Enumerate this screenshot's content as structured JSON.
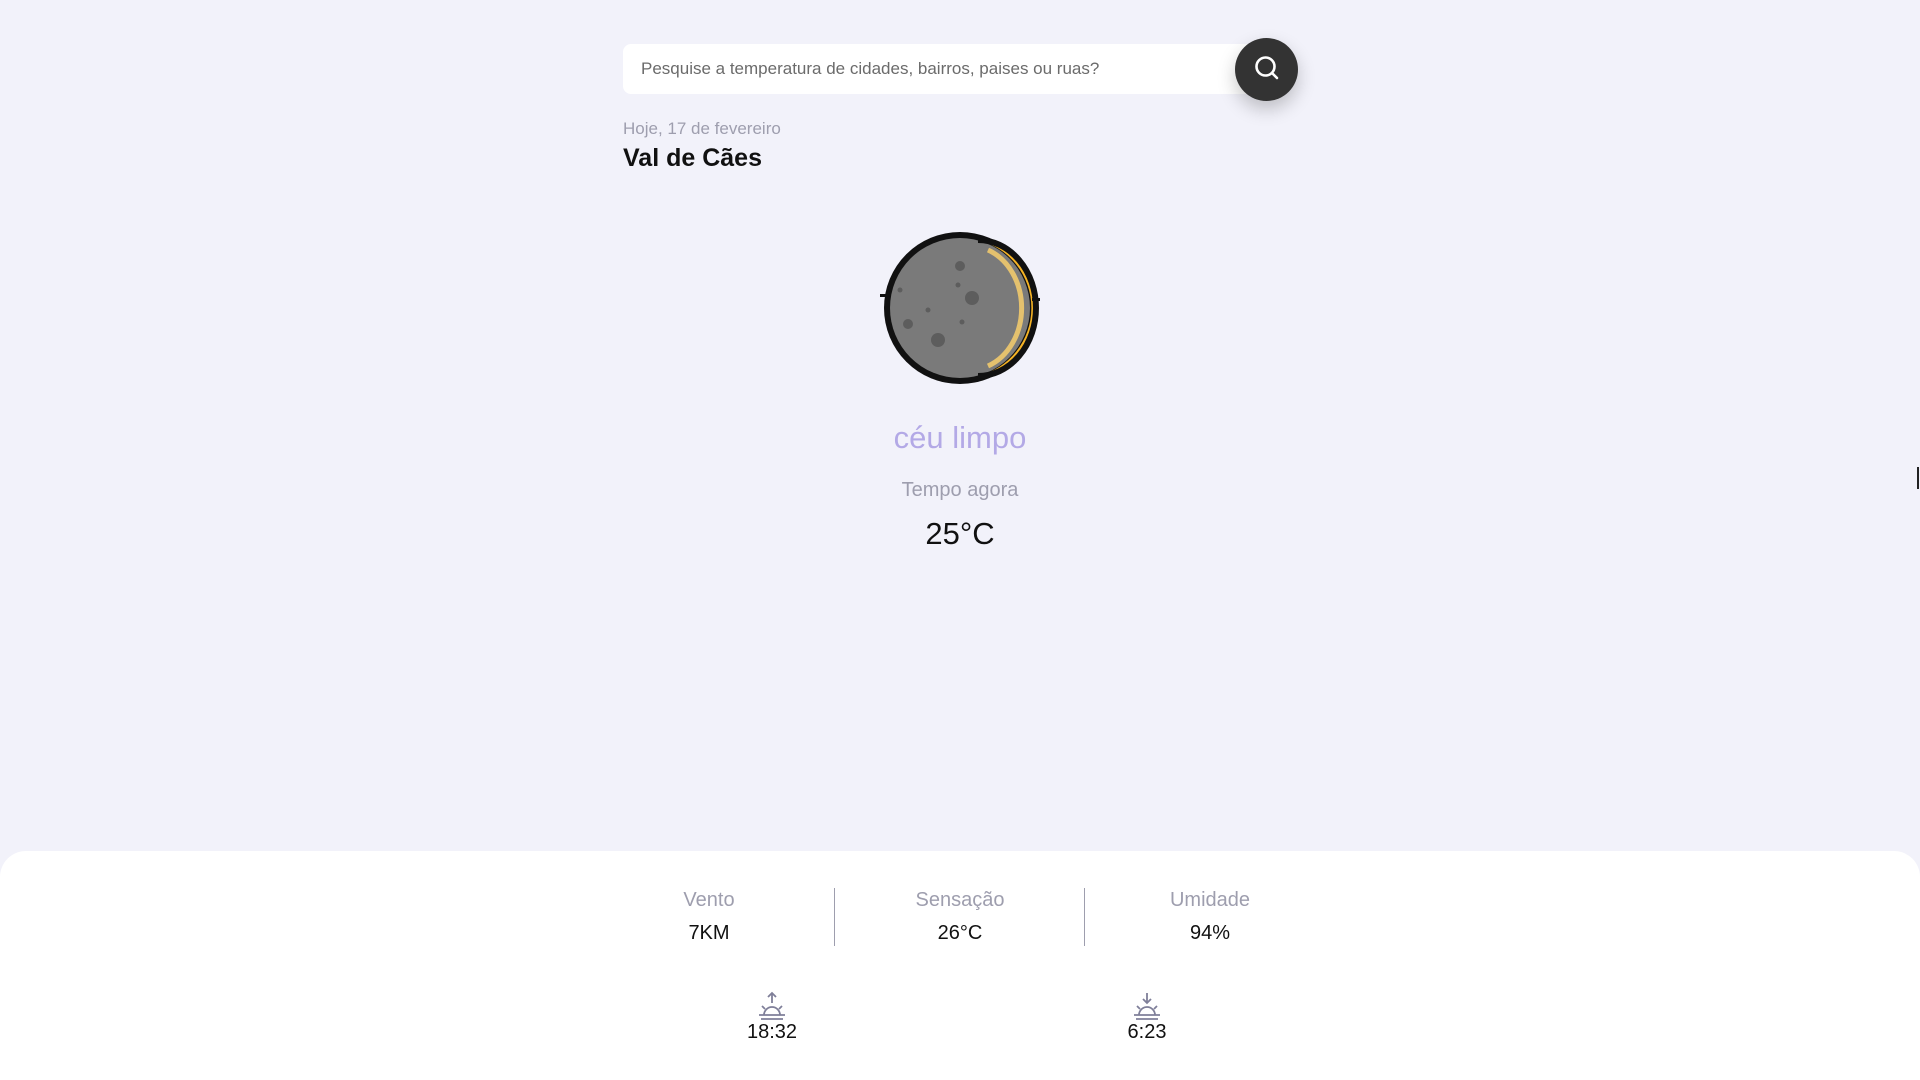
{
  "search": {
    "placeholder": "Pesquise a temperatura de cidades, bairros, paises ou ruas?",
    "value": "",
    "icon": "search-icon"
  },
  "header": {
    "date": "Hoje, 17 de fevereiro",
    "city": "Val de Cães"
  },
  "weather": {
    "icon": "moon-crescent-icon",
    "description": "céu limpo",
    "subtitle": "Tempo agora",
    "temperature": "25°C"
  },
  "stats": {
    "wind": {
      "label": "Vento",
      "value": "7KM"
    },
    "feels_like": {
      "label": "Sensação",
      "value": "26°C"
    },
    "humidity": {
      "label": "Umidade",
      "value": "94%"
    }
  },
  "sun": {
    "sunset": {
      "icon": "sunset-icon",
      "time": "18:32"
    },
    "sunrise": {
      "icon": "sunrise-icon",
      "time": "6:23"
    }
  },
  "colors": {
    "background": "#f2f2fa",
    "accent": "#b3a9e6",
    "muted": "#9e9eae",
    "button": "#333333"
  }
}
